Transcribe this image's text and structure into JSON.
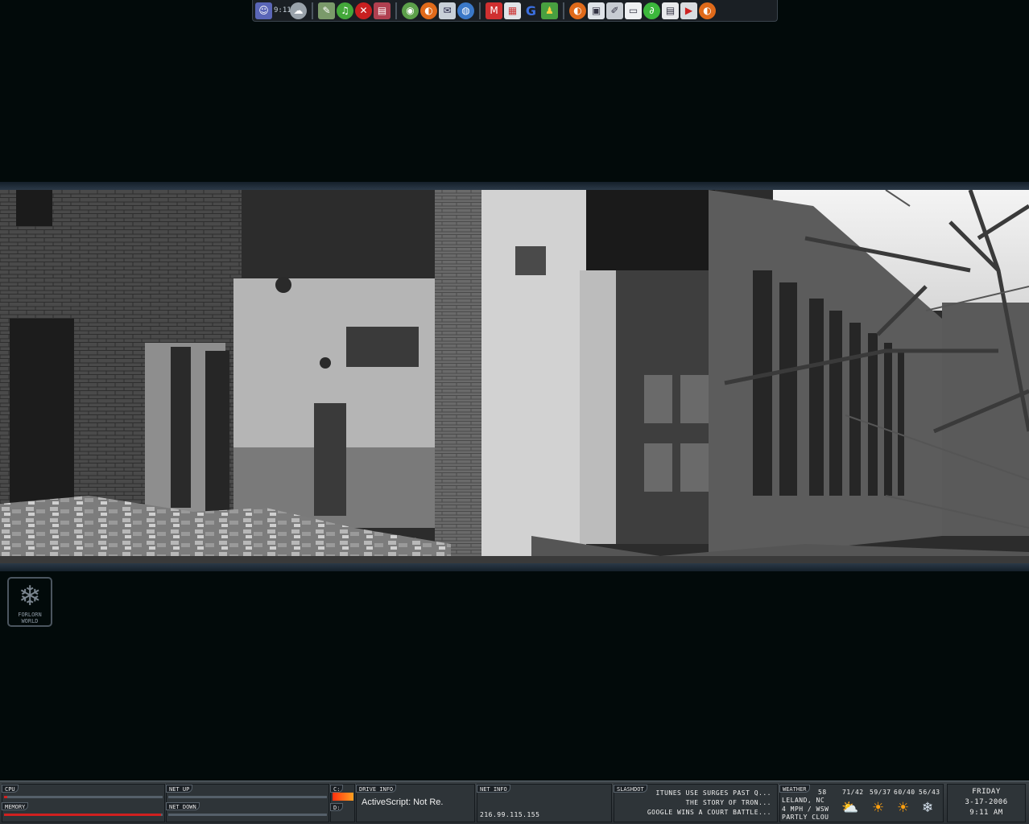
{
  "dock": {
    "clock_text": "9:11",
    "icons": [
      "user-icon",
      "weather-icon",
      "tools-icon",
      "music-icon",
      "acrobat-icon",
      "document-icon",
      "cd-icon",
      "firefox-icon",
      "mail-icon",
      "globe-icon",
      "gmail-icon",
      "office-icon",
      "google-icon",
      "users-icon",
      "firefox-icon",
      "window-icon",
      "edit-icon",
      "presentation-icon",
      "winamp-icon",
      "notes-icon",
      "media-icon",
      "firefox-icon"
    ]
  },
  "desktop": {
    "logo_line1": "FORLORN",
    "logo_line2": "WORLD"
  },
  "statusbar": {
    "cpu_label": "CPU",
    "memory_label": "MEMORY",
    "net_up_label": "NET UP",
    "net_down_label": "NET DOWN",
    "drive_c": "C:",
    "drive_d": "D:",
    "drive_info_label": "DRIVE INFO",
    "drive_info_text": "ActiveScript: Not Re.",
    "net_info_label": "NET INFO",
    "ip_address": "216.99.115.155",
    "slashdot_label": "SLASHDOT",
    "headlines": [
      "ITUNES USE SURGES PAST Q...",
      "THE STORY OF TRON...",
      "GOOGLE WINS A COURT BATTLE..."
    ],
    "weather_label": "WEATHER",
    "current_temp": "58",
    "location": "LELAND, NC",
    "wind": "4 MPH / WSW",
    "condition": "PARTLY CLOU",
    "forecast": [
      {
        "temps": "71/42",
        "icon": "partly-sunny-icon"
      },
      {
        "temps": "59/37",
        "icon": "sunny-icon"
      },
      {
        "temps": "60/40",
        "icon": "sunny-icon"
      },
      {
        "temps": "56/43",
        "icon": "snow-icon"
      }
    ],
    "day": "FRIDAY",
    "date": "3-17-2006",
    "time": "9:11 AM",
    "cpu_level": 0.02,
    "memory_level": 0.99,
    "net_up_level": 0.0,
    "net_down_level": 0.0,
    "colors": {
      "meter_fill": "#d02020",
      "drive_fill": "#ff5a10"
    }
  }
}
